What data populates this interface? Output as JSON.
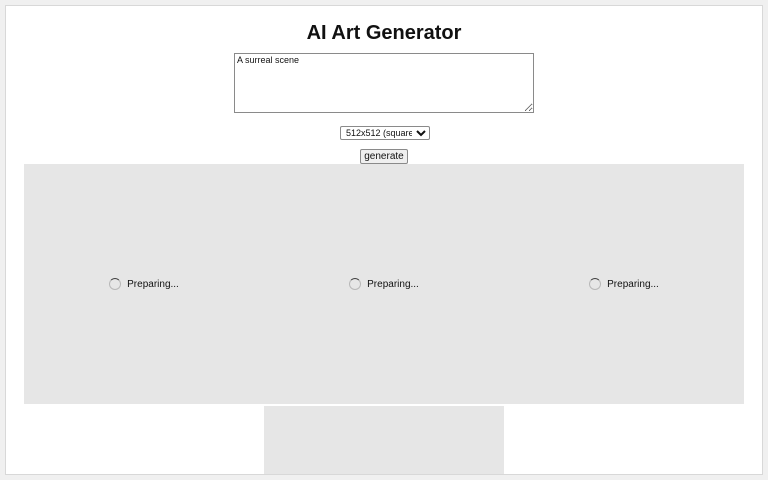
{
  "header": {
    "title": "AI Art Generator"
  },
  "form": {
    "prompt_value": "A surreal scene",
    "size_selected": "512x512 (square)",
    "generate_label": "generate"
  },
  "results": {
    "tiles": [
      {
        "status": "Preparing..."
      },
      {
        "status": "Preparing..."
      },
      {
        "status": "Preparing..."
      }
    ]
  },
  "colors": {
    "tile_background": "#e6e6e6",
    "page_background": "#ffffff"
  }
}
